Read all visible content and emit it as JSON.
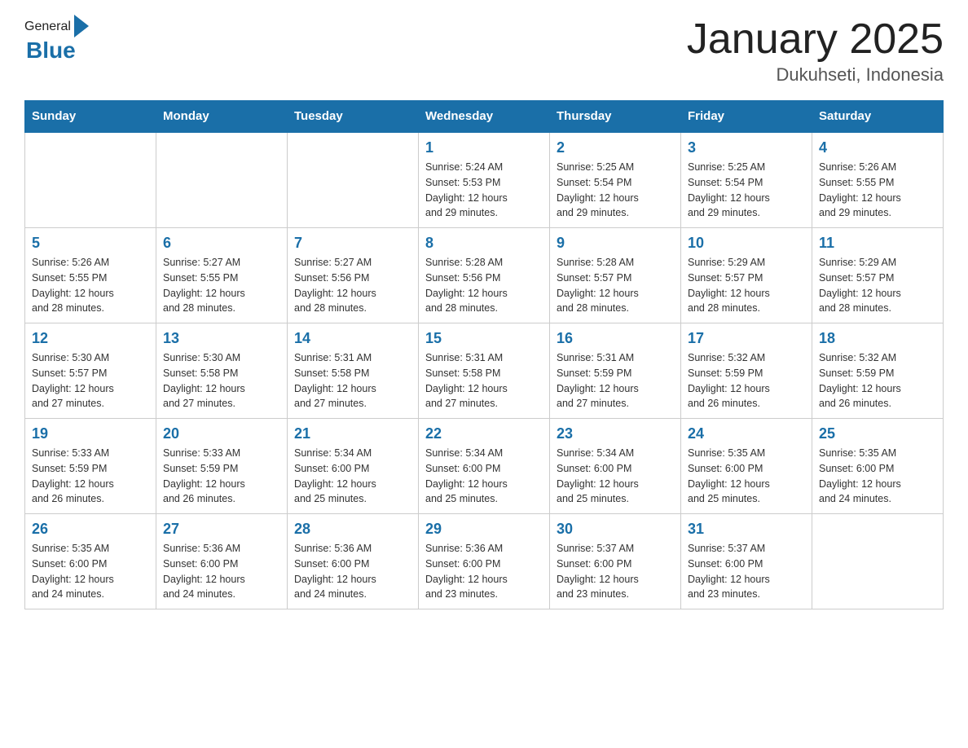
{
  "header": {
    "logo_general": "General",
    "logo_blue": "Blue",
    "title": "January 2025",
    "subtitle": "Dukuhseti, Indonesia"
  },
  "days_of_week": [
    "Sunday",
    "Monday",
    "Tuesday",
    "Wednesday",
    "Thursday",
    "Friday",
    "Saturday"
  ],
  "weeks": [
    [
      {
        "date": "",
        "info": ""
      },
      {
        "date": "",
        "info": ""
      },
      {
        "date": "",
        "info": ""
      },
      {
        "date": "1",
        "info": "Sunrise: 5:24 AM\nSunset: 5:53 PM\nDaylight: 12 hours\nand 29 minutes."
      },
      {
        "date": "2",
        "info": "Sunrise: 5:25 AM\nSunset: 5:54 PM\nDaylight: 12 hours\nand 29 minutes."
      },
      {
        "date": "3",
        "info": "Sunrise: 5:25 AM\nSunset: 5:54 PM\nDaylight: 12 hours\nand 29 minutes."
      },
      {
        "date": "4",
        "info": "Sunrise: 5:26 AM\nSunset: 5:55 PM\nDaylight: 12 hours\nand 29 minutes."
      }
    ],
    [
      {
        "date": "5",
        "info": "Sunrise: 5:26 AM\nSunset: 5:55 PM\nDaylight: 12 hours\nand 28 minutes."
      },
      {
        "date": "6",
        "info": "Sunrise: 5:27 AM\nSunset: 5:55 PM\nDaylight: 12 hours\nand 28 minutes."
      },
      {
        "date": "7",
        "info": "Sunrise: 5:27 AM\nSunset: 5:56 PM\nDaylight: 12 hours\nand 28 minutes."
      },
      {
        "date": "8",
        "info": "Sunrise: 5:28 AM\nSunset: 5:56 PM\nDaylight: 12 hours\nand 28 minutes."
      },
      {
        "date": "9",
        "info": "Sunrise: 5:28 AM\nSunset: 5:57 PM\nDaylight: 12 hours\nand 28 minutes."
      },
      {
        "date": "10",
        "info": "Sunrise: 5:29 AM\nSunset: 5:57 PM\nDaylight: 12 hours\nand 28 minutes."
      },
      {
        "date": "11",
        "info": "Sunrise: 5:29 AM\nSunset: 5:57 PM\nDaylight: 12 hours\nand 28 minutes."
      }
    ],
    [
      {
        "date": "12",
        "info": "Sunrise: 5:30 AM\nSunset: 5:57 PM\nDaylight: 12 hours\nand 27 minutes."
      },
      {
        "date": "13",
        "info": "Sunrise: 5:30 AM\nSunset: 5:58 PM\nDaylight: 12 hours\nand 27 minutes."
      },
      {
        "date": "14",
        "info": "Sunrise: 5:31 AM\nSunset: 5:58 PM\nDaylight: 12 hours\nand 27 minutes."
      },
      {
        "date": "15",
        "info": "Sunrise: 5:31 AM\nSunset: 5:58 PM\nDaylight: 12 hours\nand 27 minutes."
      },
      {
        "date": "16",
        "info": "Sunrise: 5:31 AM\nSunset: 5:59 PM\nDaylight: 12 hours\nand 27 minutes."
      },
      {
        "date": "17",
        "info": "Sunrise: 5:32 AM\nSunset: 5:59 PM\nDaylight: 12 hours\nand 26 minutes."
      },
      {
        "date": "18",
        "info": "Sunrise: 5:32 AM\nSunset: 5:59 PM\nDaylight: 12 hours\nand 26 minutes."
      }
    ],
    [
      {
        "date": "19",
        "info": "Sunrise: 5:33 AM\nSunset: 5:59 PM\nDaylight: 12 hours\nand 26 minutes."
      },
      {
        "date": "20",
        "info": "Sunrise: 5:33 AM\nSunset: 5:59 PM\nDaylight: 12 hours\nand 26 minutes."
      },
      {
        "date": "21",
        "info": "Sunrise: 5:34 AM\nSunset: 6:00 PM\nDaylight: 12 hours\nand 25 minutes."
      },
      {
        "date": "22",
        "info": "Sunrise: 5:34 AM\nSunset: 6:00 PM\nDaylight: 12 hours\nand 25 minutes."
      },
      {
        "date": "23",
        "info": "Sunrise: 5:34 AM\nSunset: 6:00 PM\nDaylight: 12 hours\nand 25 minutes."
      },
      {
        "date": "24",
        "info": "Sunrise: 5:35 AM\nSunset: 6:00 PM\nDaylight: 12 hours\nand 25 minutes."
      },
      {
        "date": "25",
        "info": "Sunrise: 5:35 AM\nSunset: 6:00 PM\nDaylight: 12 hours\nand 24 minutes."
      }
    ],
    [
      {
        "date": "26",
        "info": "Sunrise: 5:35 AM\nSunset: 6:00 PM\nDaylight: 12 hours\nand 24 minutes."
      },
      {
        "date": "27",
        "info": "Sunrise: 5:36 AM\nSunset: 6:00 PM\nDaylight: 12 hours\nand 24 minutes."
      },
      {
        "date": "28",
        "info": "Sunrise: 5:36 AM\nSunset: 6:00 PM\nDaylight: 12 hours\nand 24 minutes."
      },
      {
        "date": "29",
        "info": "Sunrise: 5:36 AM\nSunset: 6:00 PM\nDaylight: 12 hours\nand 23 minutes."
      },
      {
        "date": "30",
        "info": "Sunrise: 5:37 AM\nSunset: 6:00 PM\nDaylight: 12 hours\nand 23 minutes."
      },
      {
        "date": "31",
        "info": "Sunrise: 5:37 AM\nSunset: 6:00 PM\nDaylight: 12 hours\nand 23 minutes."
      },
      {
        "date": "",
        "info": ""
      }
    ]
  ]
}
